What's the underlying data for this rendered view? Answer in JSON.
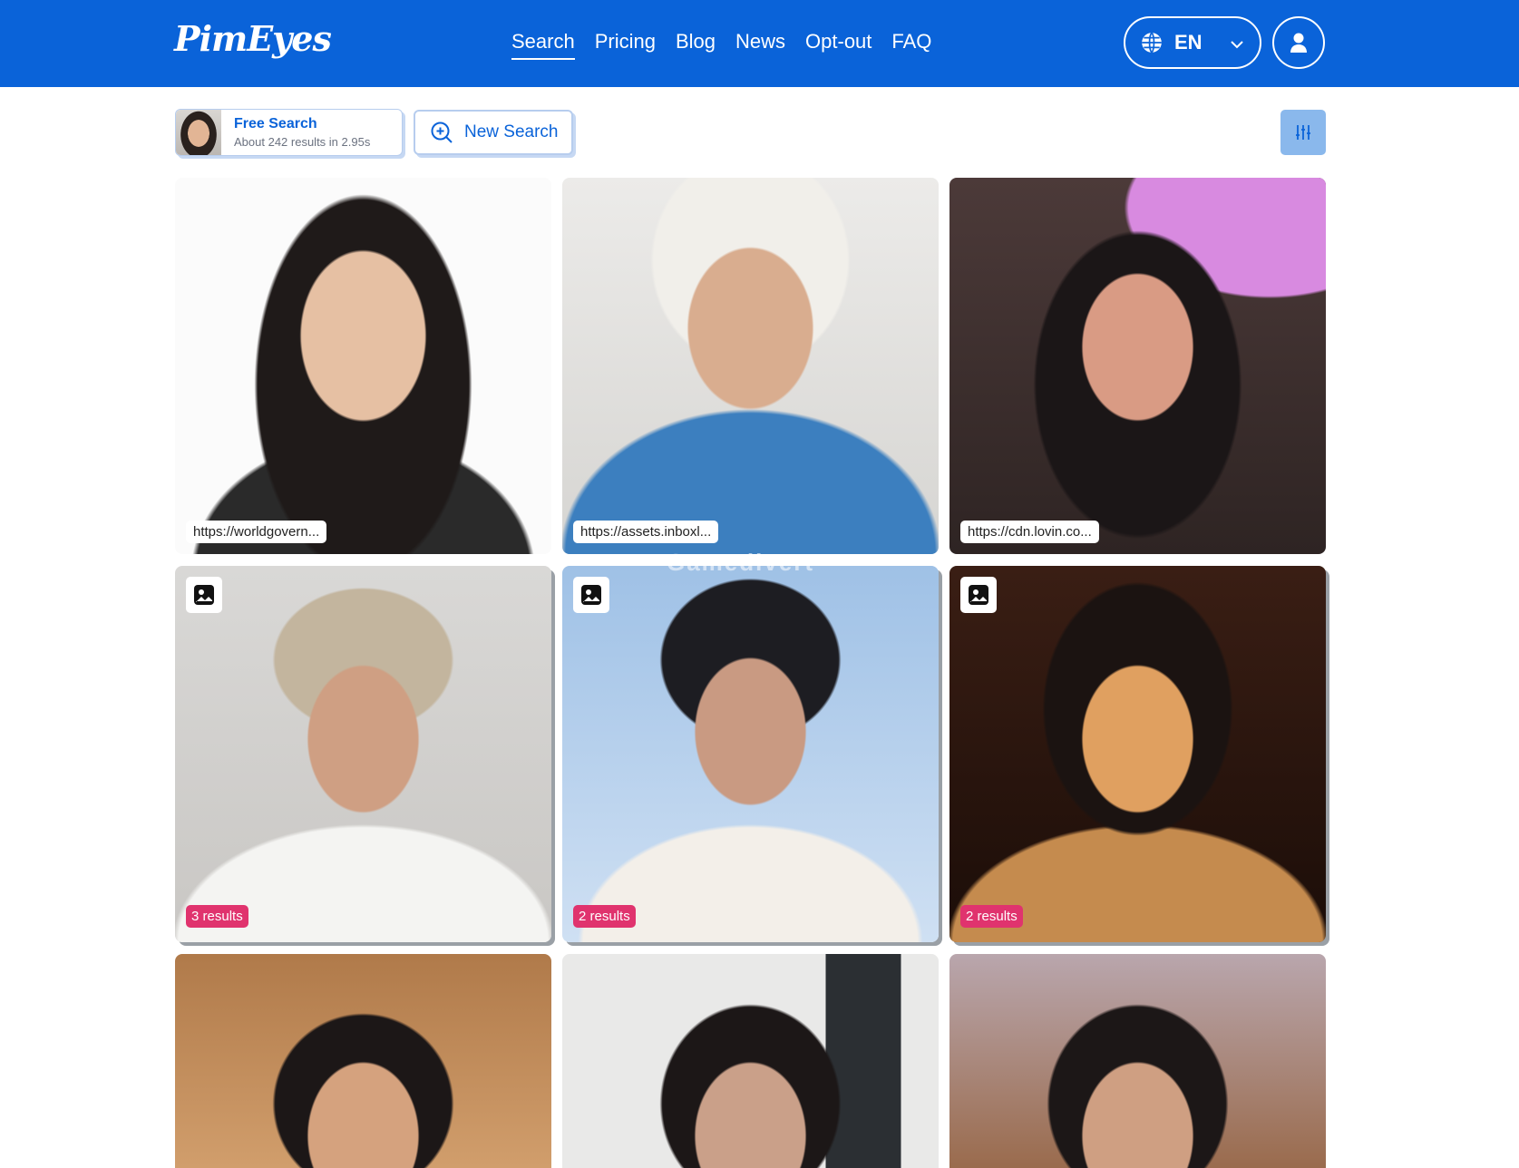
{
  "header": {
    "logo": "PimEyes",
    "nav": [
      "Search",
      "Pricing",
      "Blog",
      "News",
      "Opt-out",
      "FAQ"
    ],
    "active_nav": "Search",
    "language": "EN"
  },
  "toolbar": {
    "free_search_title": "Free Search",
    "free_search_sub": "About 242 results in 2.95s",
    "new_search_label": "New Search"
  },
  "results": [
    {
      "url": "https://worldgovern...",
      "count": ""
    },
    {
      "url": "https://assets.inboxl...",
      "count": ""
    },
    {
      "url": "https://cdn.lovin.co...",
      "count": ""
    },
    {
      "url": "",
      "count": "3 results"
    },
    {
      "url": "",
      "count": "2 results"
    },
    {
      "url": "",
      "count": "2 results"
    }
  ],
  "watermark": "Gamedivert",
  "colors": {
    "brand": "#0a63d9",
    "badge": "#e0336e",
    "filter_button": "#8ab8ec"
  },
  "icons": [
    "globe-icon",
    "chevron-down-icon",
    "user-icon",
    "search-plus-icon",
    "sliders-icon",
    "image-icon"
  ]
}
